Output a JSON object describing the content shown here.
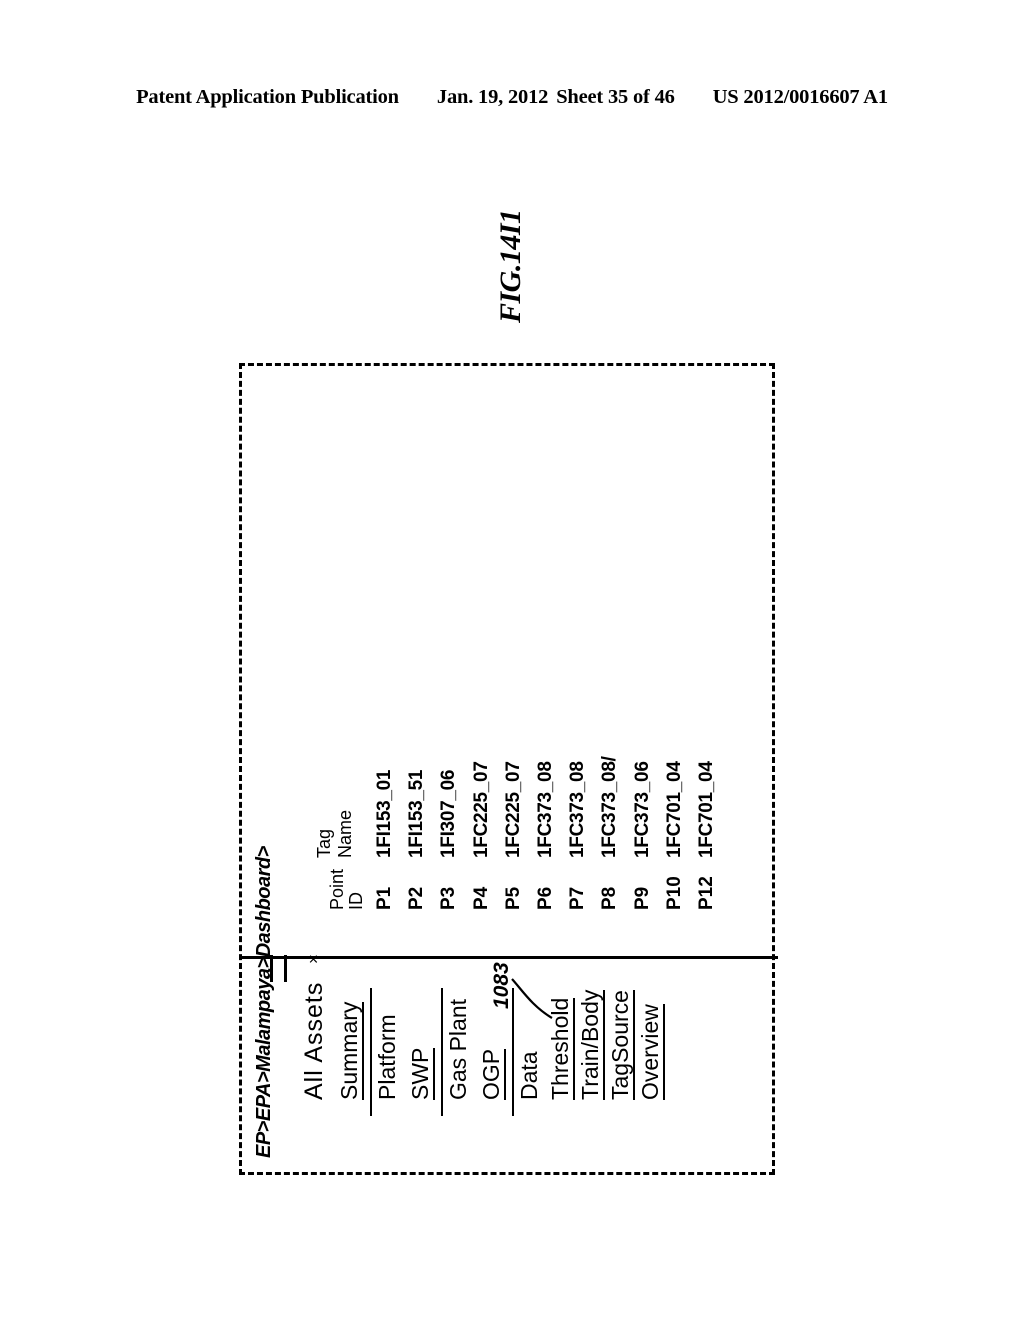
{
  "patent_header": {
    "publication": "Patent Application Publication",
    "date": "Jan. 19, 2012",
    "sheet": "Sheet 35 of 46",
    "number": "US 2012/0016607 A1"
  },
  "figure": {
    "caption": "FIG.14I1",
    "callout_number": "1083"
  },
  "ui": {
    "breadcrumb": "EP>EPA>Malampaya>Dashboard>",
    "tab": {
      "label": "All Assets",
      "close": "×"
    },
    "nav_groups": [
      {
        "items": [
          {
            "label": "Summary",
            "underlined": true
          }
        ]
      },
      {
        "items": [
          {
            "label": "Platform",
            "underlined": false
          },
          {
            "label": "SWP",
            "underlined": true
          }
        ]
      },
      {
        "items": [
          {
            "label": "Gas  Plant",
            "underlined": false
          },
          {
            "label": "OGP",
            "underlined": true
          }
        ]
      },
      {
        "items": [
          {
            "label": "Data",
            "underlined": false
          },
          {
            "label": "Threshold",
            "underlined": true
          },
          {
            "label": "Train/Body",
            "underlined": true
          },
          {
            "label": "TagSource",
            "underlined": true
          },
          {
            "label": "Overview",
            "underlined": true
          }
        ]
      }
    ],
    "table": {
      "columns": [
        {
          "key": "point_id",
          "header": "Point\nID"
        },
        {
          "key": "tag_name",
          "header": "Tag Name"
        }
      ],
      "rows": [
        {
          "point_id": "P1",
          "tag_name": "1FI153_01"
        },
        {
          "point_id": "P2",
          "tag_name": "1FI153_51"
        },
        {
          "point_id": "P3",
          "tag_name": "1FI307_06"
        },
        {
          "point_id": "P4",
          "tag_name": "1FC225_07"
        },
        {
          "point_id": "P5",
          "tag_name": "1FC225_07"
        },
        {
          "point_id": "P6",
          "tag_name": "1FC373_08"
        },
        {
          "point_id": "P7",
          "tag_name": "1FC373_08"
        },
        {
          "point_id": "P8",
          "tag_name": "1FC373_08/"
        },
        {
          "point_id": "P9",
          "tag_name": "1FC373_06"
        },
        {
          "point_id": "P10",
          "tag_name": "1FC701_04"
        },
        {
          "point_id": "P12",
          "tag_name": "1FC701_04"
        }
      ]
    }
  }
}
